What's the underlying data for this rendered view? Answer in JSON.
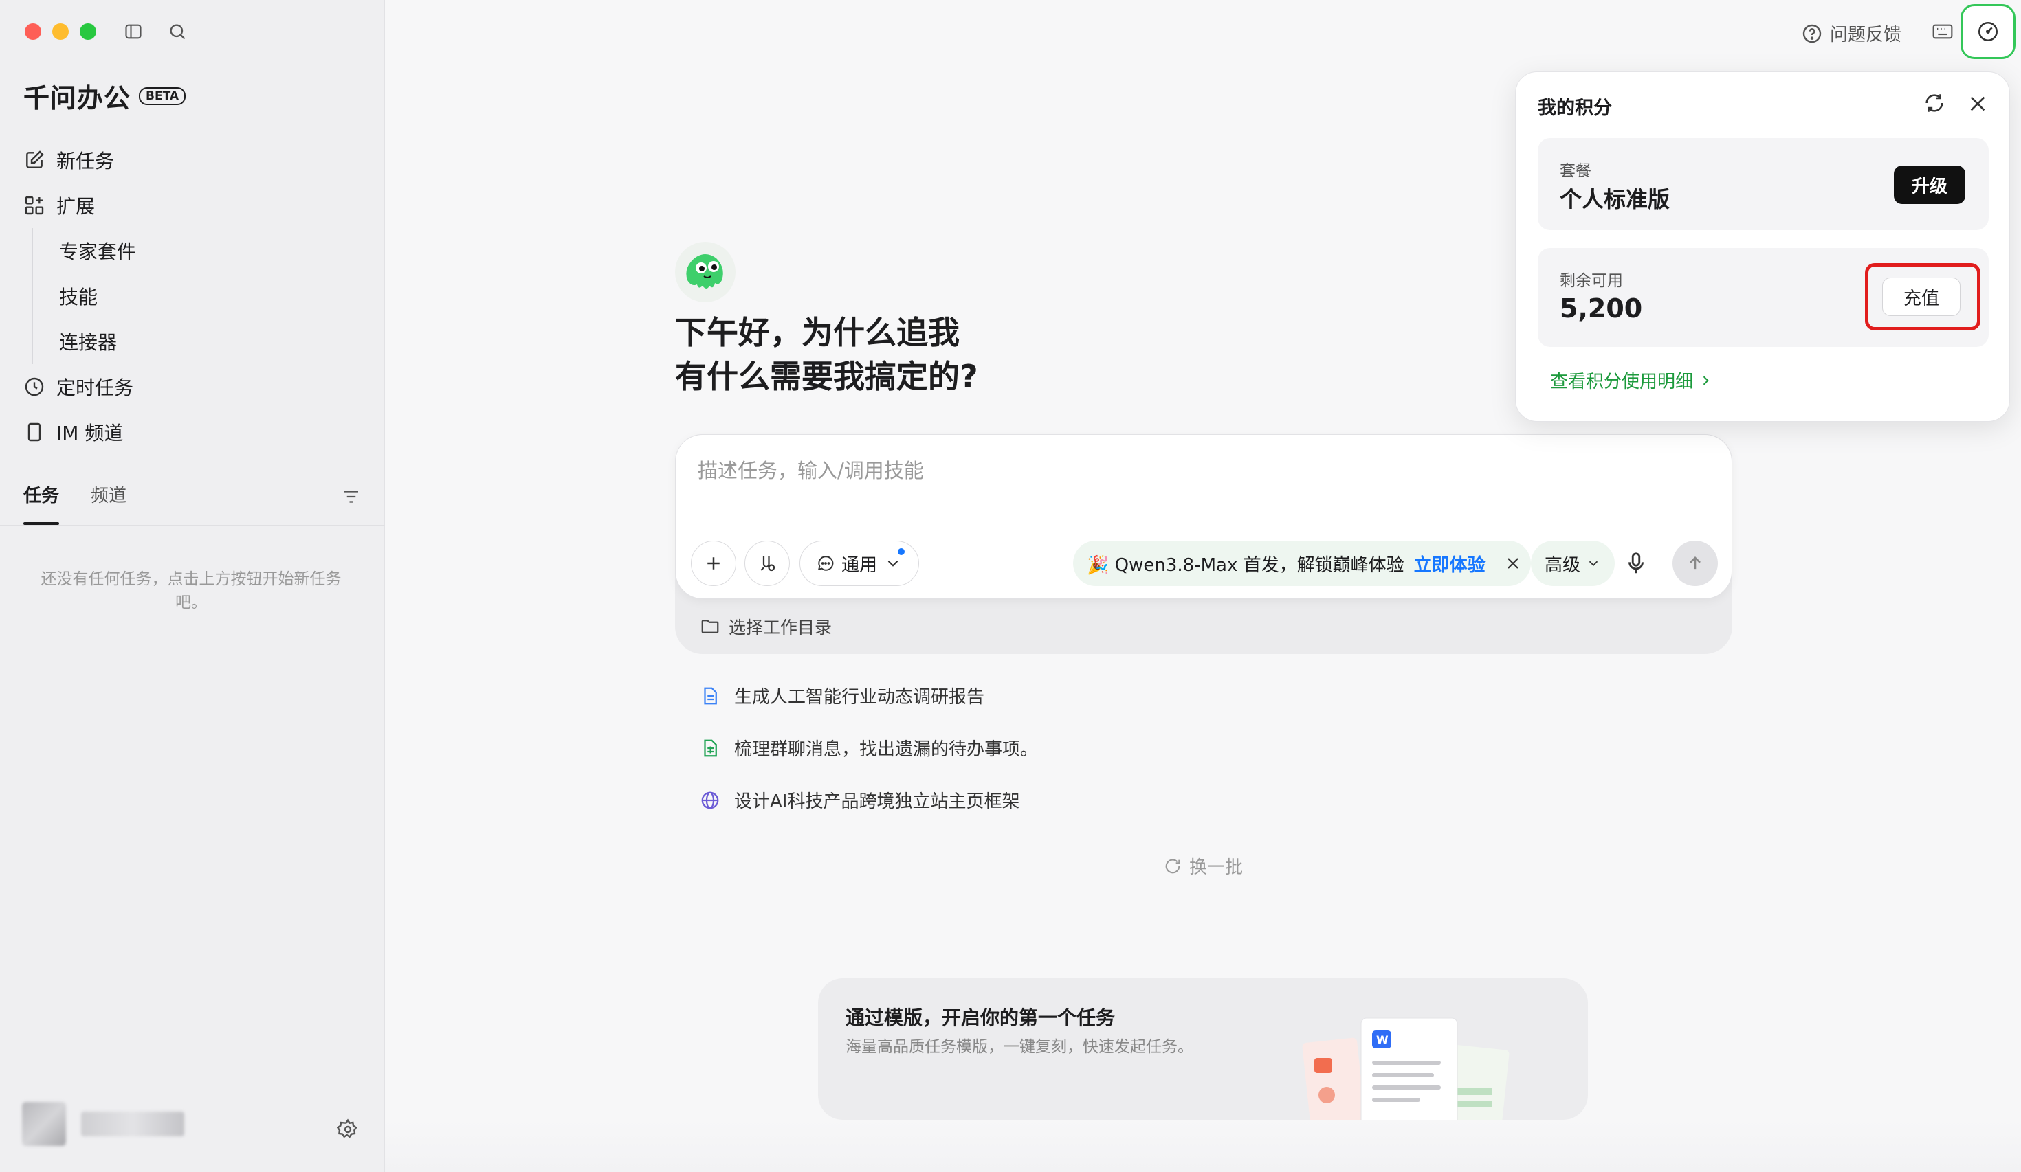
{
  "sidebar": {
    "brand": "千问办公",
    "badge": "BETA",
    "nav": {
      "new_task": "新任务",
      "extensions": "扩展",
      "expert_suite": "专家套件",
      "skills": "技能",
      "connectors": "连接器",
      "scheduled": "定时任务",
      "im_channel": "IM 频道"
    },
    "tabs": {
      "tasks": "任务",
      "channels": "频道"
    },
    "empty_tip": "还没有任何任务，点击上方按钮开始新任务吧。"
  },
  "topbar": {
    "feedback": "问题反馈"
  },
  "main": {
    "greeting_line1": "下午好，为什么追我",
    "greeting_line2": "有什么需要我搞定的?",
    "composer": {
      "placeholder": "描述任务，输入/调用技能",
      "mode": "通用",
      "promo_text": "🎉 Qwen3.8-Max 首发，解锁巅峰体验",
      "promo_link": "立即体验",
      "level": "高级",
      "workdir": "选择工作目录"
    },
    "suggestions": [
      "生成人工智能行业动态调研报告",
      "梳理群聊消息，找出遗漏的待办事项。",
      "设计AI科技产品跨境独立站主页框架"
    ],
    "refresh": "换一批",
    "template_card": {
      "title": "通过模版，开启你的第一个任务",
      "subtitle": "海量高品质任务模版，一键复刻，快速发起任务。"
    }
  },
  "points_popup": {
    "title": "我的积分",
    "plan_label": "套餐",
    "plan_value": "个人标准版",
    "upgrade": "升级",
    "remaining_label": "剩余可用",
    "remaining_value": "5,200",
    "recharge": "充值",
    "detail_link": "查看积分使用明细"
  },
  "colors": {
    "accent_green": "#34c759",
    "link_blue": "#1677ff",
    "highlight_red": "#e11d1d"
  }
}
